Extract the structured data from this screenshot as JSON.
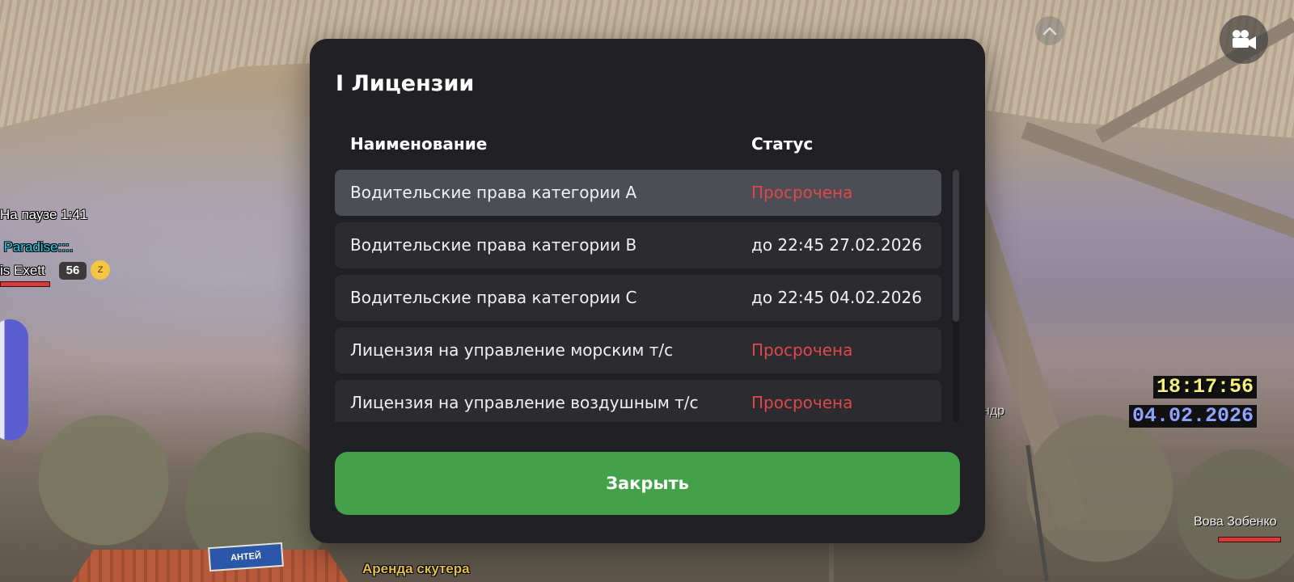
{
  "modal": {
    "title": "I Лицензии",
    "columns": {
      "name": "Наименование",
      "status": "Статус"
    },
    "rows": [
      {
        "name": "Водительские права категории A",
        "status": "Просрочена",
        "expired": true,
        "selected": true
      },
      {
        "name": "Водительские права категории B",
        "status": "до 22:45 27.02.2026",
        "expired": false,
        "selected": false
      },
      {
        "name": "Водительские права категории C",
        "status": "до 22:45 04.02.2026",
        "expired": false,
        "selected": false
      },
      {
        "name": "Лицензия на управление морским т/с",
        "status": "Просрочена",
        "expired": true,
        "selected": false
      },
      {
        "name": "Лицензия на управление воздушным т/с",
        "status": "Просрочена",
        "expired": true,
        "selected": false
      }
    ],
    "close_label": "Закрыть"
  },
  "hud": {
    "pause_text": "На паузе 1:41",
    "clan_name": "l Paradise:::.",
    "player_name": "is Exett",
    "player_level": "56",
    "clock_time": "18:17:56",
    "clock_date": "04.02.2026",
    "rental_label": "Аренда скутера",
    "nearby_player": "Вова Зобенко",
    "partial_label": "ндр",
    "store_sign": "АНТЕЙ"
  },
  "icons": {
    "scroll_up": "chevron-up-icon",
    "camera": "video-camera-icon",
    "status_emoji": "sleeping-emoji-icon"
  },
  "colors": {
    "modal_bg": "#212125",
    "row_bg": "#2b2b30",
    "row_selected_bg": "#4d4d55",
    "expired": "#e0494b",
    "close_button": "#42a149",
    "clan_text": "#22d3ee",
    "clock_time": "#f5f07a",
    "clock_date": "#8ea3ff"
  }
}
